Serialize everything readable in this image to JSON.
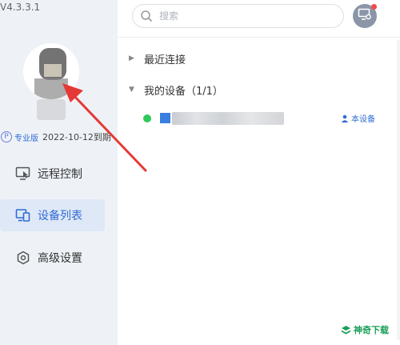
{
  "app": {
    "version": "V4.3.3.1"
  },
  "profile": {
    "pro_letter": "P",
    "pro_badge": "专业版",
    "expiry": "2022-10-12到期"
  },
  "nav": {
    "remote_control": "远程控制",
    "device_list": "设备列表",
    "advanced_settings": "高级设置"
  },
  "search": {
    "placeholder": "搜索"
  },
  "sections": {
    "recent": "最近连接",
    "my_devices": "我的设备（1/1）"
  },
  "device": {
    "status": "online",
    "this_device_label": "本设备"
  },
  "watermark": {
    "text": "神奇下载"
  },
  "colors": {
    "accent": "#2f6bd6",
    "online": "#2fc85a",
    "annotation_arrow": "#e53935",
    "notification": "#f14b4b"
  }
}
